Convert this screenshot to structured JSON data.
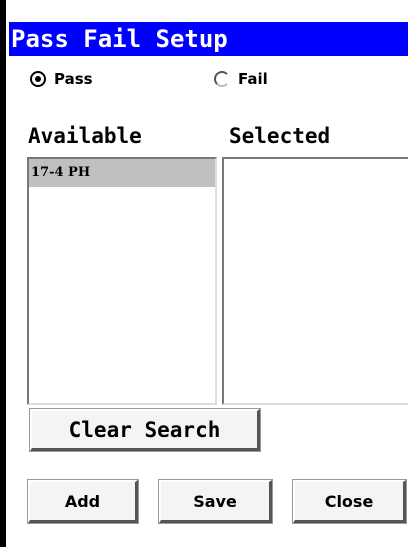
{
  "window": {
    "title": "Pass Fail Setup"
  },
  "mode": {
    "options": [
      {
        "label": "Pass",
        "selected": true
      },
      {
        "label": "Fail",
        "selected": false
      }
    ]
  },
  "lists": {
    "available_label": "Available",
    "selected_label": "Selected",
    "available_items": [
      "17-4 PH"
    ],
    "selected_items": []
  },
  "buttons": {
    "clear_search": "Clear Search",
    "add": "Add",
    "save": "Save",
    "close": "Close"
  },
  "colors": {
    "title_bar": "#0000ff",
    "title_text": "#ffffff",
    "frame": "#000000",
    "list_item_highlight": "#c0c0c0"
  }
}
